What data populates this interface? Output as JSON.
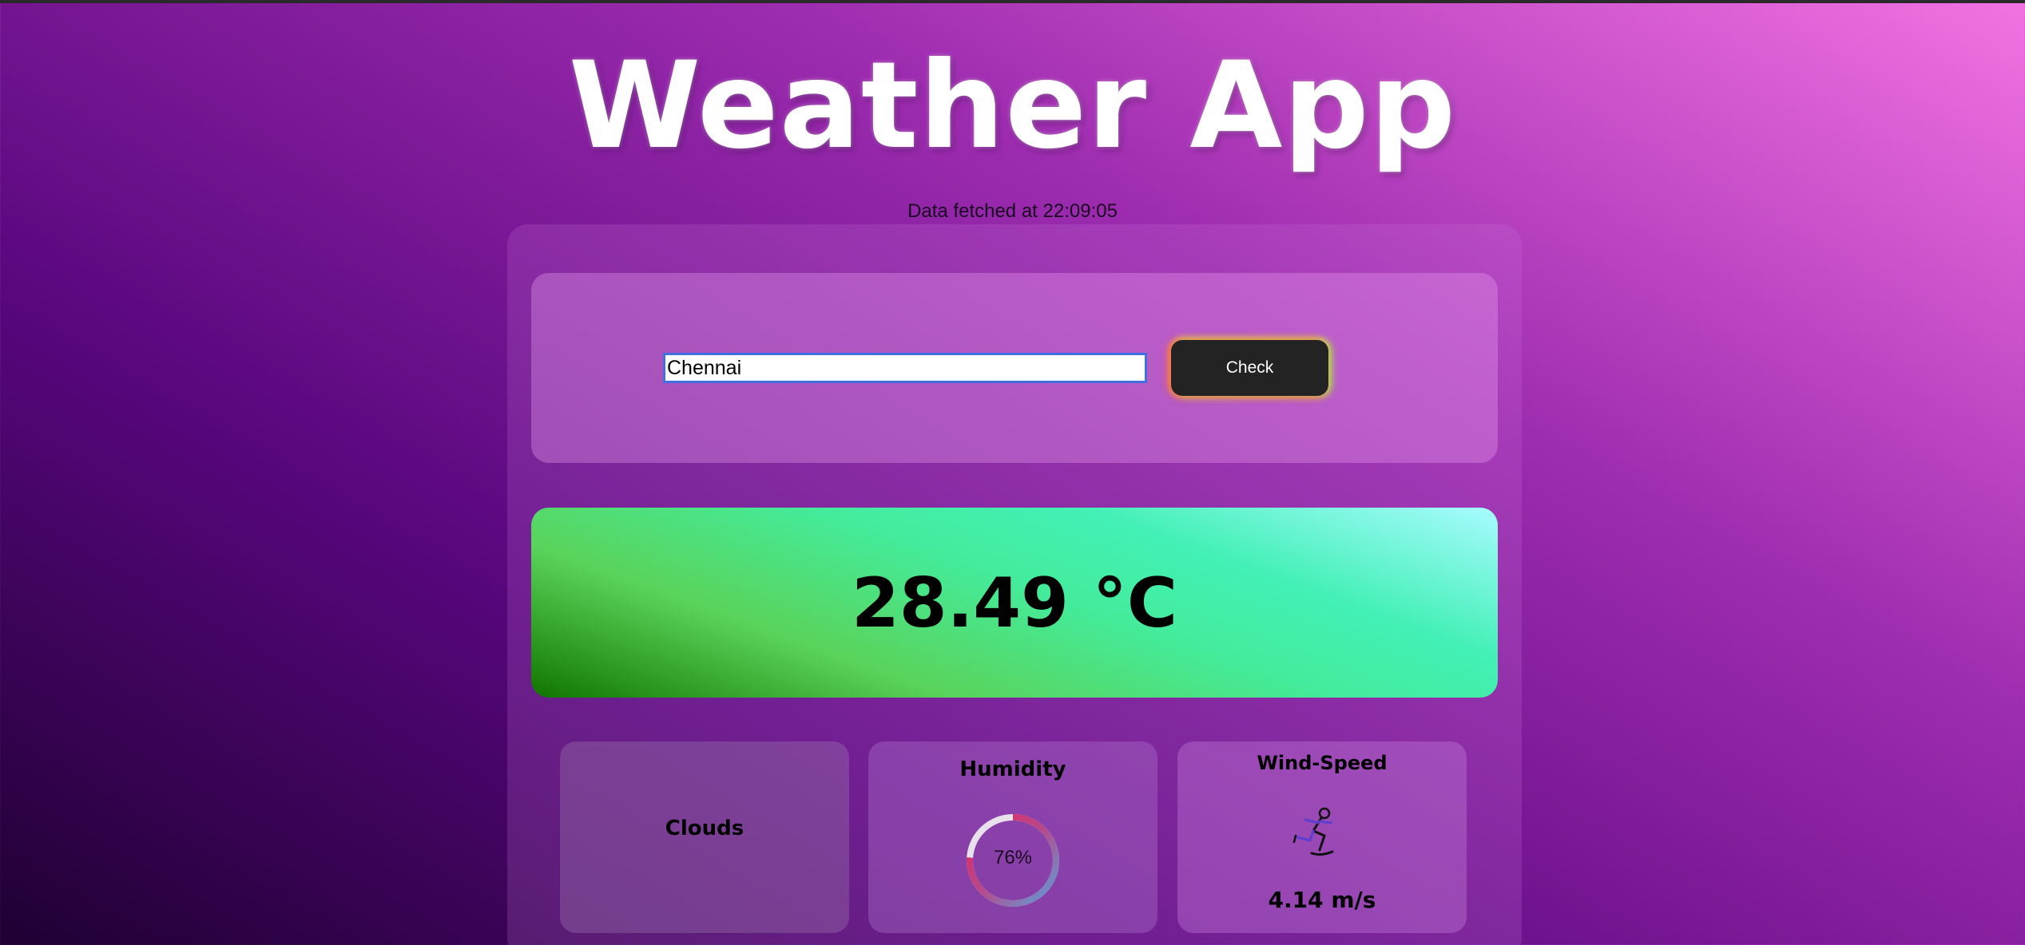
{
  "app": {
    "title": "Weather App",
    "fetched_text": "Data fetched at 22:09:05"
  },
  "search": {
    "input_value": "Chennai",
    "check_label": "Check"
  },
  "temperature": {
    "display": "28.49 °C"
  },
  "stats": {
    "clouds_label": "Clouds",
    "humidity_label": "Humidity",
    "humidity_text": "76%",
    "humidity_percent": 76,
    "wind_label": "Wind-Speed",
    "wind_value": "4.14 m/s",
    "wind_icon": "ice-skater-icon"
  },
  "colors": {
    "button_bg": "#232323",
    "input_border": "#3f6fe0",
    "gauge_start": "#5aa0d8",
    "gauge_end": "#e8245a"
  }
}
